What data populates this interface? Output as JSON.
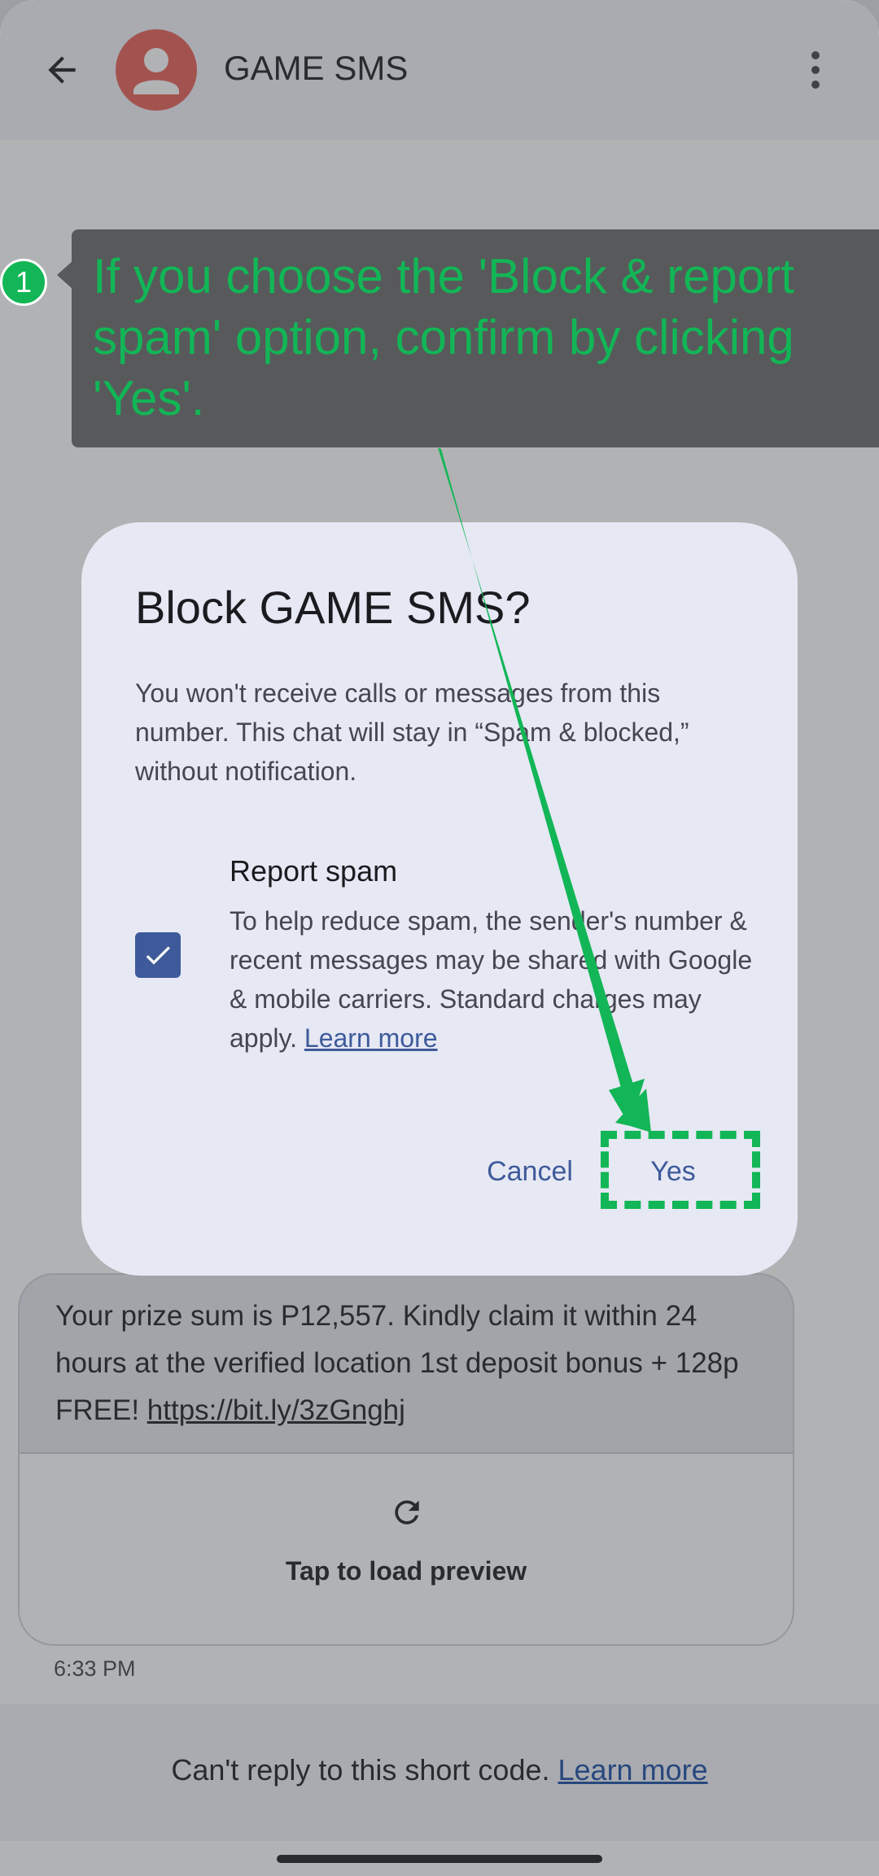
{
  "header": {
    "contact_name": "GAME SMS",
    "back_icon": "arrow-back-icon",
    "avatar_icon": "person-icon",
    "more_icon": "more-vert-icon"
  },
  "message": {
    "text": "Your prize sum is P12,557. Kindly claim it within 24 hours at the verified location 1st deposit bonus + 128p FREE! ",
    "link": "https://bit.ly/3zGnghj",
    "preview_label": "Tap to load preview",
    "preview_icon": "refresh-icon",
    "time": "6:33 PM"
  },
  "footer": {
    "text": "Can't reply to this short code. ",
    "link": "Learn more"
  },
  "dialog": {
    "title": "Block GAME SMS?",
    "body": "You won't receive calls or messages from this number. This chat will stay in “Spam & blocked,” without notification.",
    "report_title": "Report spam",
    "report_desc": "To help reduce spam, the sender's number & recent messages may be shared with Google & mobile carriers. Standard charges may apply. ",
    "report_link": "Learn more",
    "checkbox_checked": true,
    "cancel_label": "Cancel",
    "yes_label": "Yes"
  },
  "annotation": {
    "step": "1",
    "text": "If you choose the 'Block & report spam' option, confirm by clicking 'Yes'.",
    "color": "#12b656"
  },
  "colors": {
    "accent": "#3e5a9a",
    "avatar": "#e86258",
    "dialog_bg": "#e6e8f4"
  }
}
